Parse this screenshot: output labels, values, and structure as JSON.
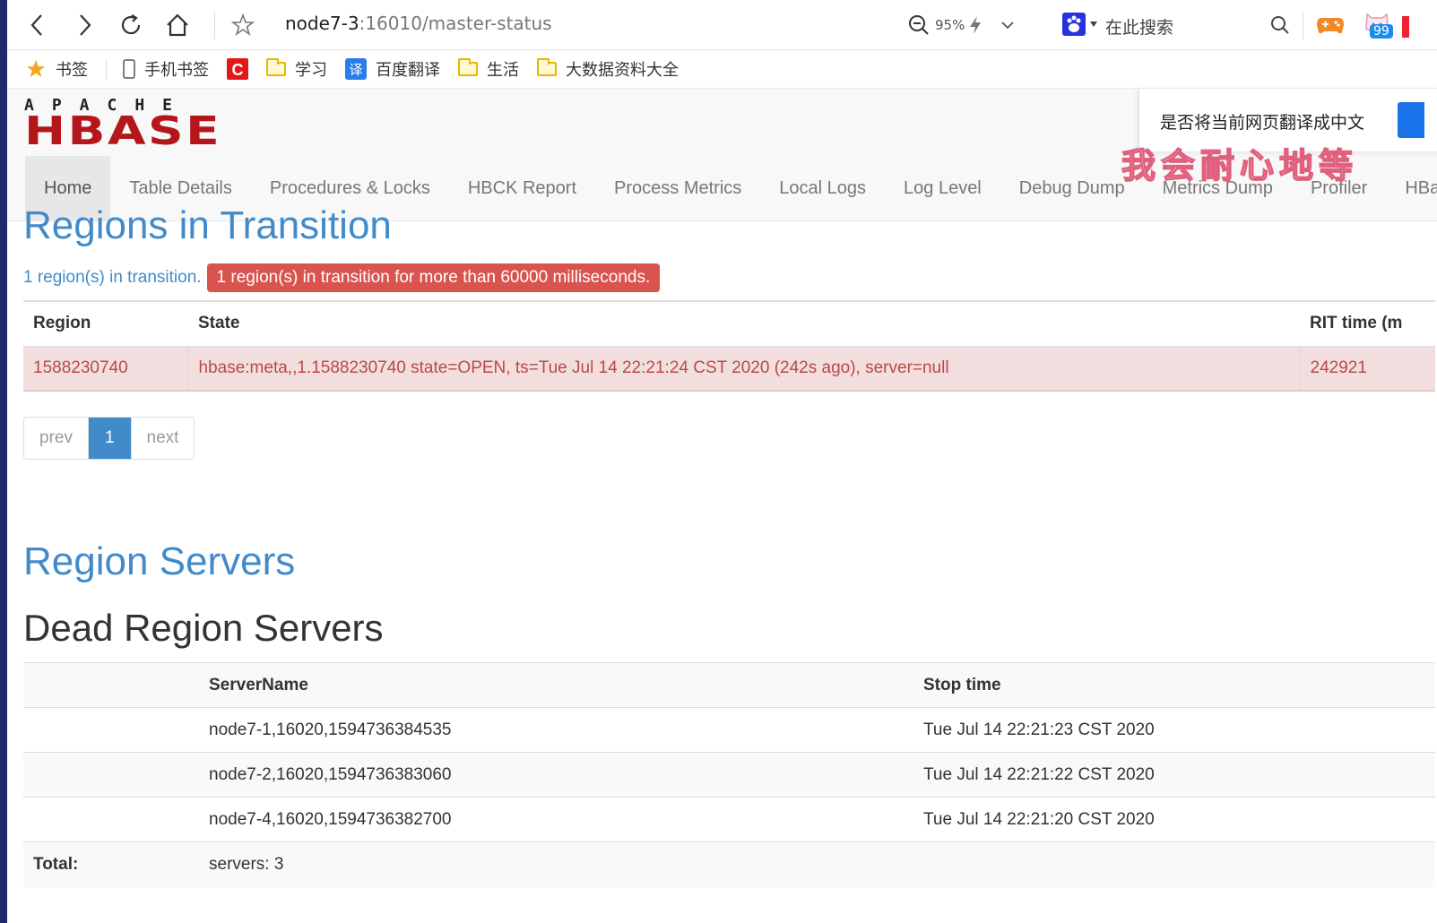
{
  "browser": {
    "url_host": "node7-3",
    "url_port_path": ":16010/master-status",
    "zoom_level": "95%",
    "search_placeholder": "在此搜索",
    "notification_count": "99"
  },
  "bookmarks": [
    {
      "label": "书签",
      "icon": "star-icon"
    },
    {
      "label": "手机书签",
      "icon": "phone-icon"
    },
    {
      "label": "",
      "icon": "csdn-icon"
    },
    {
      "label": "学习",
      "icon": "folder-icon"
    },
    {
      "label": "百度翻译",
      "icon": "translate-icon"
    },
    {
      "label": "生活",
      "icon": "folder-icon"
    },
    {
      "label": "大数据资料大全",
      "icon": "folder-icon"
    }
  ],
  "header": {
    "logo_top": "APACHE",
    "logo_main": "HBASE",
    "nav": [
      "Home",
      "Table Details",
      "Procedures & Locks",
      "HBCK Report",
      "Process Metrics",
      "Local Logs",
      "Log Level",
      "Debug Dump",
      "Metrics Dump",
      "Profiler",
      "HBa"
    ],
    "translate_prompt": "是否将当前网页翻译成中文",
    "watermark": "我会耐心地等"
  },
  "rit": {
    "title": "Regions in Transition",
    "count_text": "1 region(s) in transition.",
    "alert_text": "1 region(s) in transition for more than 60000 milliseconds.",
    "columns": [
      "Region",
      "State",
      "RIT time (m"
    ],
    "rows": [
      {
        "region": "1588230740",
        "state": "hbase:meta,,1.1588230740 state=OPEN, ts=Tue Jul 14 22:21:24 CST 2020 (242s ago), server=null",
        "rit_time": "242921"
      }
    ],
    "pager": {
      "prev": "prev",
      "current": "1",
      "next": "next"
    }
  },
  "region_servers": {
    "title": "Region Servers"
  },
  "dead_servers": {
    "title": "Dead Region Servers",
    "columns": [
      "",
      "ServerName",
      "Stop time"
    ],
    "rows": [
      {
        "server": "node7-1,16020,1594736384535",
        "stop": "Tue Jul 14 22:21:23 CST 2020"
      },
      {
        "server": "node7-2,16020,1594736383060",
        "stop": "Tue Jul 14 22:21:22 CST 2020"
      },
      {
        "server": "node7-4,16020,1594736382700",
        "stop": "Tue Jul 14 22:21:20 CST 2020"
      }
    ],
    "total_label": "Total:",
    "total_value": "servers: 3"
  },
  "colors": {
    "link_blue": "#428bca",
    "danger_red": "#d9534f",
    "hbase_red": "#b3171c",
    "desktop_bg": "#1e2a6e"
  }
}
